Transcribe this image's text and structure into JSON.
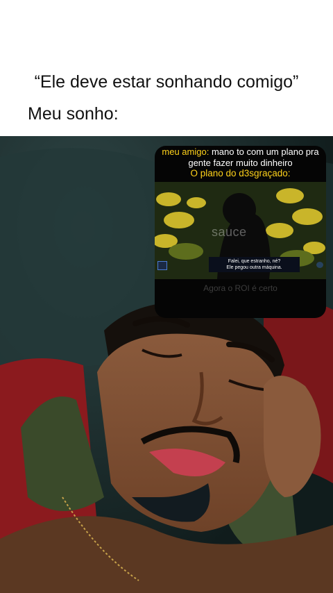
{
  "caption": {
    "line1": "“Ele deve estar sonhando comigo”",
    "line2": "Meu sonho:"
  },
  "overlay": {
    "text_highlight": "meu amigo:",
    "text_rest": " mano to com um plano pra gente fazer muito dinheiro",
    "title": "O plano do d3sgraçado:",
    "video_subtitle_line1": "Falei, que estranho, né?",
    "video_subtitle_line2": "Ele pegou outra máquina.",
    "watermark": "sauce",
    "bottom_text": "Agora o ROI é certo"
  }
}
